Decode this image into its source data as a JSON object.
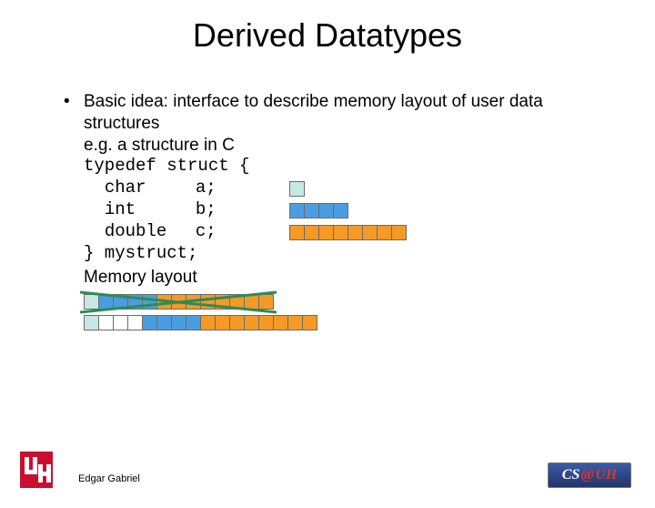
{
  "title": "Derived Datatypes",
  "bullet": "Basic idea: interface to describe memory layout of user data structures",
  "eg_line": "e.g. a structure in C",
  "code": {
    "l1": "typedef struct {",
    "a_type": "char",
    "a_name": "a;",
    "b_type": "int",
    "b_name": "b;",
    "c_type": "double",
    "c_name": "c;",
    "l5": "} mystruct;"
  },
  "memory_label": "Memory layout",
  "colors": {
    "char": "#c7e8e2",
    "int": "#4a9de0",
    "double": "#f49a25",
    "padding": "#ffffff"
  },
  "legend": {
    "char_cells": 1,
    "int_cells": 4,
    "double_cells": 8
  },
  "layout_rows": [
    {
      "crossed": true,
      "cells": [
        "char",
        "int",
        "int",
        "int",
        "int",
        "double",
        "double",
        "double",
        "double",
        "double",
        "double",
        "double",
        "double"
      ]
    },
    {
      "crossed": false,
      "cells": [
        "char",
        "padding",
        "padding",
        "padding",
        "int",
        "int",
        "int",
        "int",
        "double",
        "double",
        "double",
        "double",
        "double",
        "double",
        "double",
        "double"
      ]
    }
  ],
  "author": "Edgar Gabriel",
  "badge": {
    "cs": "CS",
    "at": "@",
    "uh": "UH"
  }
}
